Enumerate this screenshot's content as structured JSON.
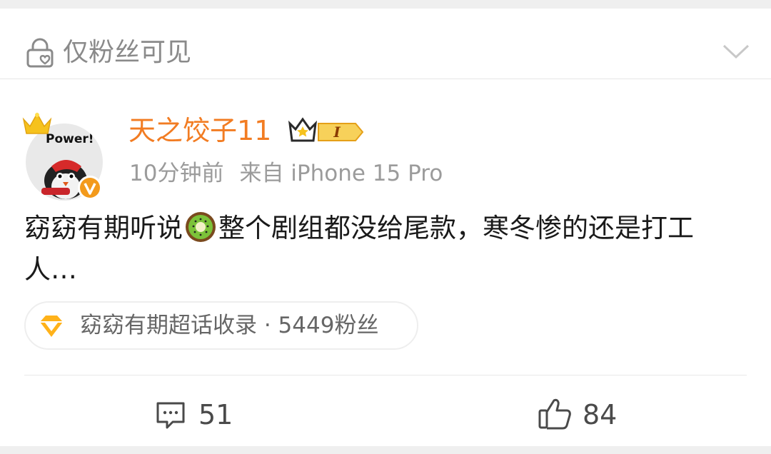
{
  "header": {
    "visibility_label": "仅粉丝可见",
    "visibility_icon": "lock-heart-icon",
    "expand_icon": "chevron-down-icon"
  },
  "post": {
    "avatar_text": "Power!",
    "user_name": "天之饺子11",
    "vip_badge_text": "I",
    "time": "10分钟前",
    "source": "来自 iPhone 15 Pro",
    "text_before_emoji": "窈窈有期听说",
    "emoji": "kiwi-emoji",
    "text_after_emoji": "整个剧组都没给尾款，寒冬惨的还是打工人…",
    "topic_chip": "窈窈有期超话收录 · 5449粉丝"
  },
  "actions": {
    "comments": "51",
    "likes": "84"
  },
  "colors": {
    "username": "#f27c22",
    "meta": "#9b9b9b",
    "badge_orange": "#f39a1c"
  }
}
